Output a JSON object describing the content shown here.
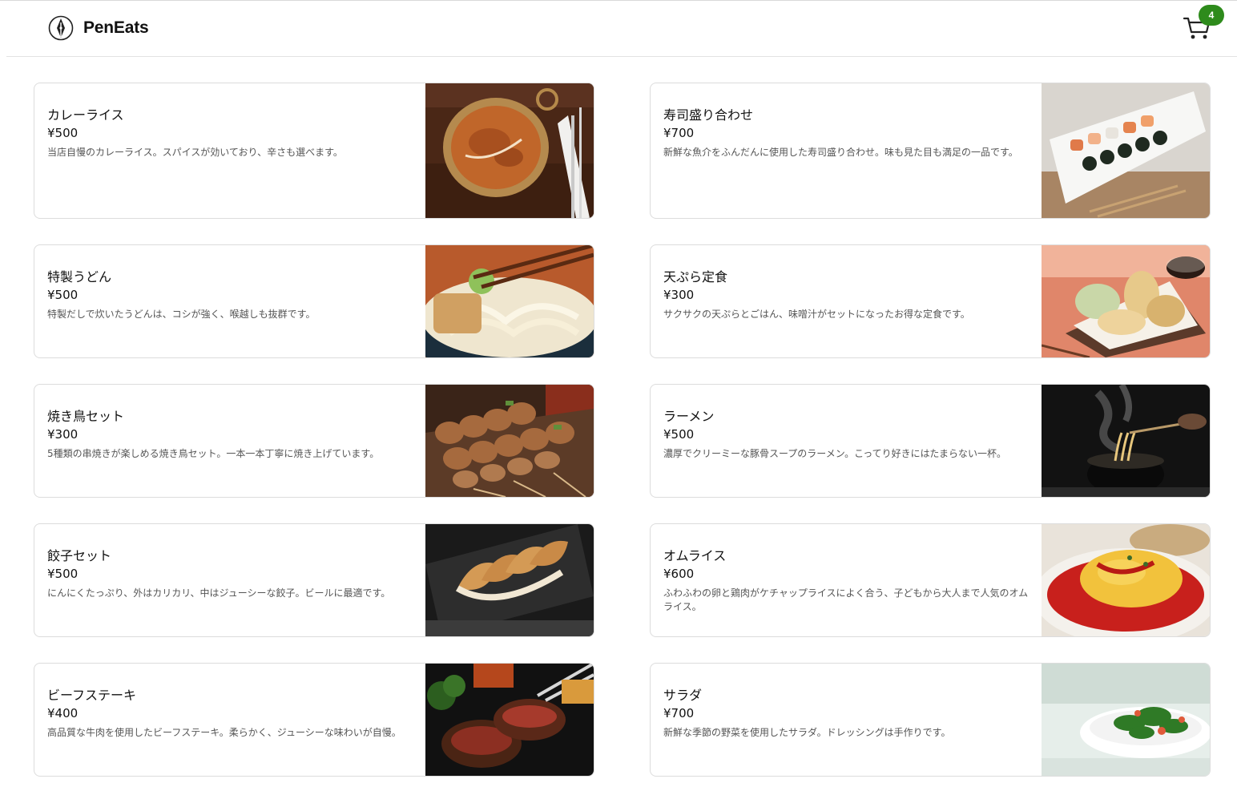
{
  "header": {
    "brand": "PenEats",
    "cart_count": "4",
    "logo_icon": "pen-nib-logo-icon",
    "cart_icon": "shopping-cart-icon"
  },
  "menu": [
    {
      "name": "カレーライス",
      "price": "¥500",
      "description": "当店自慢のカレーライス。スパイスが効いており、辛さも選べます。",
      "image": "curry-photo"
    },
    {
      "name": "寿司盛り合わせ",
      "price": "¥700",
      "description": "新鮮な魚介をふんだんに使用した寿司盛り合わせ。味も見た目も満足の一品です。",
      "image": "sushi-photo"
    },
    {
      "name": "特製うどん",
      "price": "¥500",
      "description": "特製だしで炊いたうどんは、コシが強く、喉越しも抜群です。",
      "image": "udon-photo"
    },
    {
      "name": "天ぷら定食",
      "price": "¥300",
      "description": "サクサクの天ぷらとごはん、味噌汁がセットになったお得な定食です。",
      "image": "tempura-photo"
    },
    {
      "name": "焼き鳥セット",
      "price": "¥300",
      "description": "5種類の串焼きが楽しめる焼き鳥セット。一本一本丁寧に焼き上げています。",
      "image": "yakitori-photo"
    },
    {
      "name": "ラーメン",
      "price": "¥500",
      "description": "濃厚でクリーミーな豚骨スープのラーメン。こってり好きにはたまらない一杯。",
      "image": "ramen-photo"
    },
    {
      "name": "餃子セット",
      "price": "¥500",
      "description": "にんにくたっぷり、外はカリカリ、中はジューシーな餃子。ビールに最適です。",
      "image": "gyoza-photo"
    },
    {
      "name": "オムライス",
      "price": "¥600",
      "description": "ふわふわの卵と鶏肉がケチャップライスによく合う、子どもから大人まで人気のオムライス。",
      "image": "omurice-photo"
    },
    {
      "name": "ビーフステーキ",
      "price": "¥400",
      "description": "高品質な牛肉を使用したビーフステーキ。柔らかく、ジューシーな味わいが自慢。",
      "image": "steak-photo"
    },
    {
      "name": "サラダ",
      "price": "¥700",
      "description": "新鮮な季節の野菜を使用したサラダ。ドレッシングは手作りです。",
      "image": "salad-photo"
    }
  ]
}
